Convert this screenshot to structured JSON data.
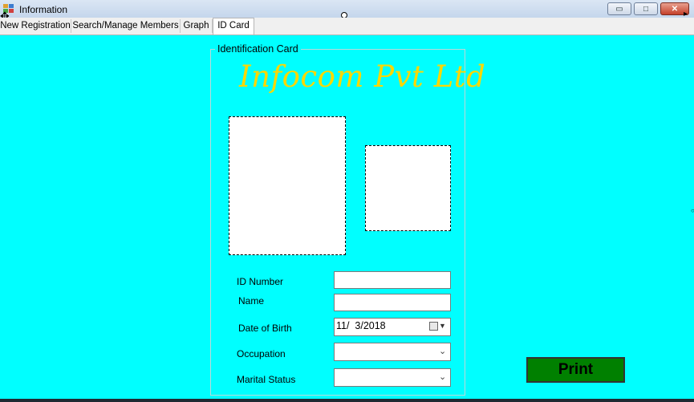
{
  "window": {
    "title": "Information",
    "controls": {
      "minimize": "▭",
      "maximize": "□",
      "close": "✕"
    }
  },
  "tabs": [
    {
      "label": "New Registration"
    },
    {
      "label": "Search/Manage Members"
    },
    {
      "label": "Graph"
    },
    {
      "label": "ID Card",
      "selected": true
    }
  ],
  "id_card": {
    "group_title": "Identification Card",
    "company_name": "Infocom Pvt Ltd",
    "company_color": "#ffd700",
    "background_color": "#00ffff",
    "fields": {
      "id_number": {
        "label": "ID Number",
        "value": ""
      },
      "name": {
        "label": "Name",
        "value": ""
      },
      "date_of_birth": {
        "label": "Date of Birth",
        "value": "11/  3/2018"
      },
      "occupation": {
        "label": "Occupation",
        "value": ""
      },
      "marital_status": {
        "label": "Marital Status",
        "value": ""
      }
    }
  },
  "print_button": {
    "label": "Print",
    "color": "#008000"
  },
  "icons": {
    "app": "app-icon",
    "move": "move-crosshair-icon",
    "calendar": "calendar-icon",
    "dropdown": "chevron-down-icon"
  }
}
